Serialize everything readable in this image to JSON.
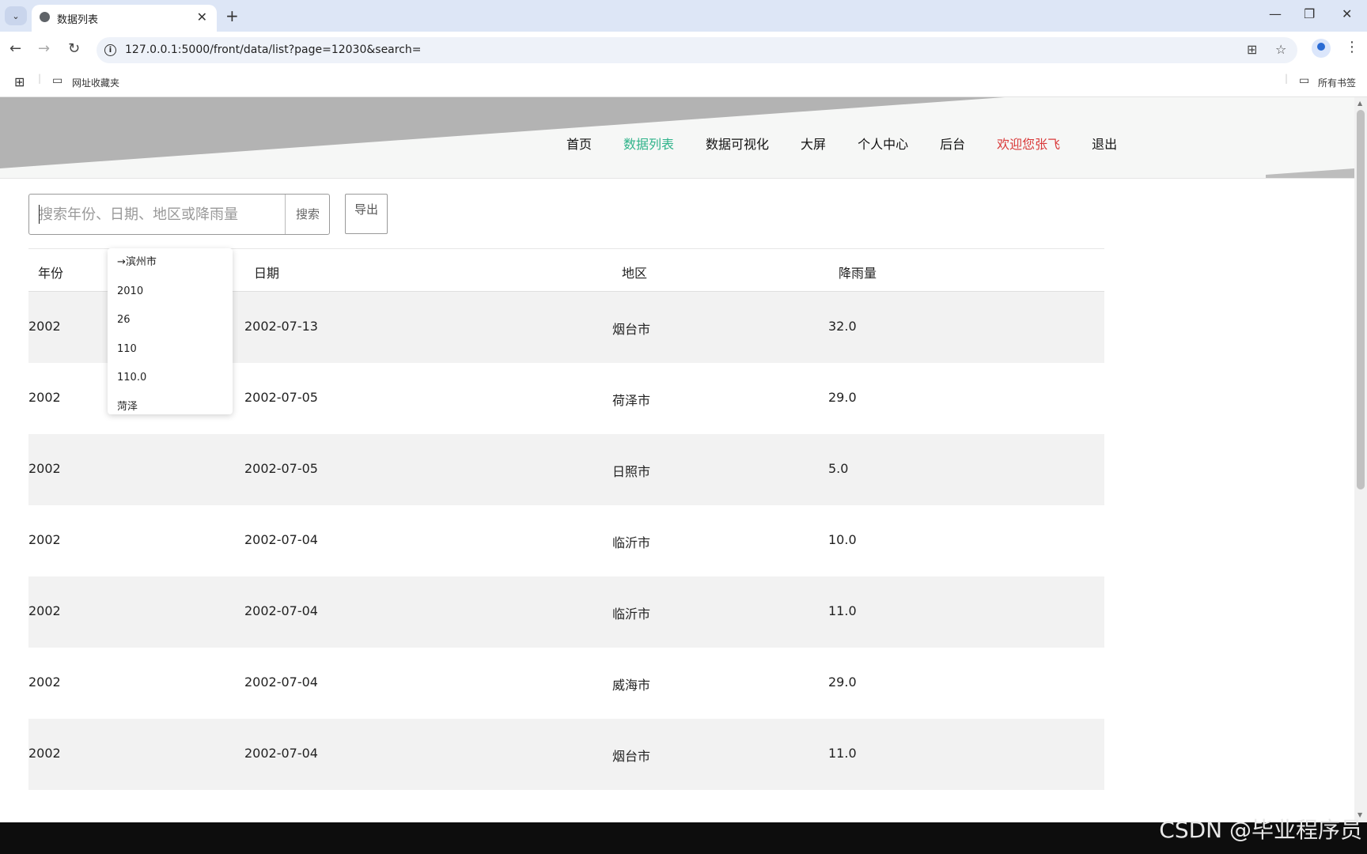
{
  "browser": {
    "tab_title": "数据列表",
    "url": "127.0.0.1:5000/front/data/list?page=12030&search=",
    "bookmarks": [
      "网址收藏夹"
    ],
    "all_bookmarks": "所有书签"
  },
  "nav": {
    "items": [
      "首页",
      "数据列表",
      "数据可视化",
      "大屏",
      "个人中心",
      "后台"
    ],
    "welcome": "欢迎您张飞",
    "logout": "退出"
  },
  "search": {
    "placeholder": "搜索年份、日期、地区或降雨量",
    "button": "搜索",
    "export": "导出"
  },
  "autocomplete": [
    "→滨州市",
    "2010",
    "26",
    "110",
    "110.0",
    "菏泽"
  ],
  "table": {
    "headers": [
      "年份",
      "日期",
      "地区",
      "降雨量"
    ],
    "rows": [
      [
        "2002",
        "2002-07-13",
        "烟台市",
        "32.0"
      ],
      [
        "2002",
        "2002-07-05",
        "荷泽市",
        "29.0"
      ],
      [
        "2002",
        "2002-07-05",
        "日照市",
        "5.0"
      ],
      [
        "2002",
        "2002-07-04",
        "临沂市",
        "10.0"
      ],
      [
        "2002",
        "2002-07-04",
        "临沂市",
        "11.0"
      ],
      [
        "2002",
        "2002-07-04",
        "威海市",
        "29.0"
      ],
      [
        "2002",
        "2002-07-04",
        "烟台市",
        "11.0"
      ]
    ]
  },
  "watermark": "CSDN @毕业程序员"
}
